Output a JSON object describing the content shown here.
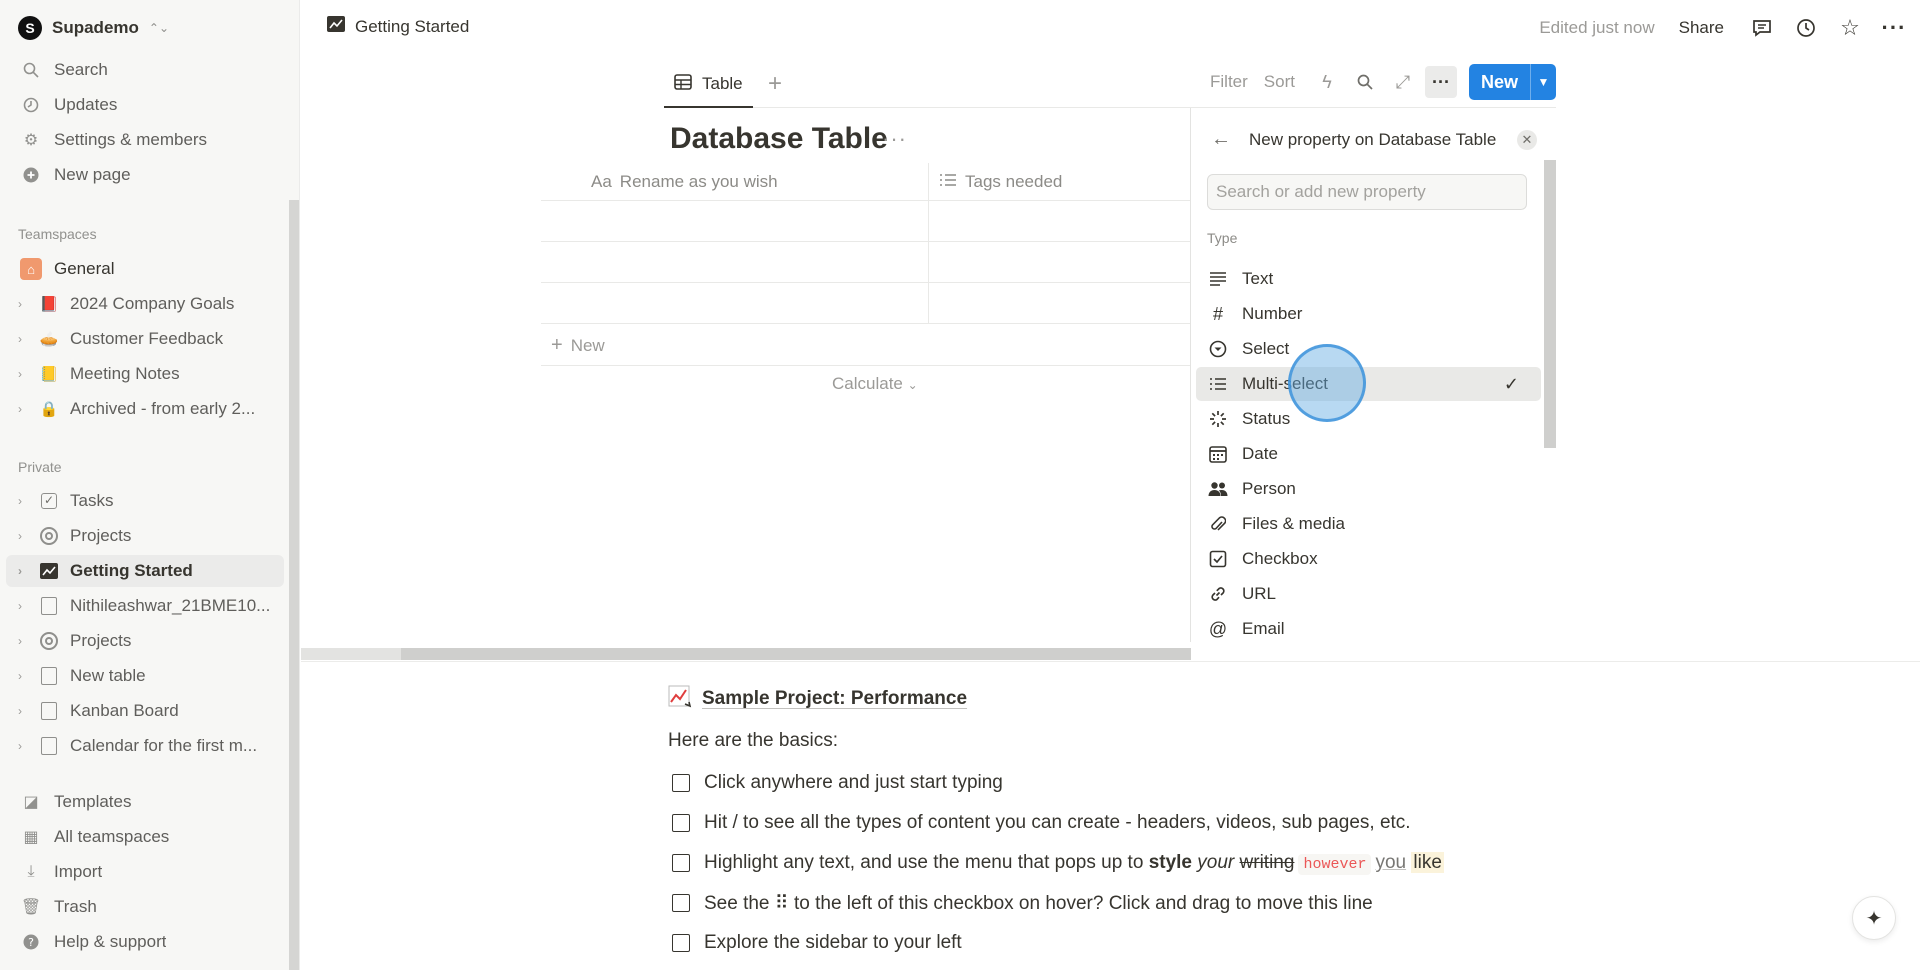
{
  "workspace": {
    "name": "Supademo",
    "logo_letter": "S"
  },
  "sidebar": {
    "top_items": [
      {
        "label": "Search",
        "icon": "search-icon"
      },
      {
        "label": "Updates",
        "icon": "clock-icon"
      },
      {
        "label": "Settings & members",
        "icon": "gear-icon"
      },
      {
        "label": "New page",
        "icon": "plus-circle-icon"
      }
    ],
    "teamspaces_label": "Teamspaces",
    "teamspaces": [
      {
        "label": "General",
        "icon": "home-icon"
      },
      {
        "label": "2024 Company Goals",
        "icon": "book-icon"
      },
      {
        "label": "Customer Feedback",
        "icon": "bowl-icon"
      },
      {
        "label": "Meeting Notes",
        "icon": "notebook-icon"
      },
      {
        "label": "Archived - from early 2...",
        "icon": "lock-icon"
      }
    ],
    "private_label": "Private",
    "private": [
      {
        "label": "Tasks",
        "icon": "checkbox-icon"
      },
      {
        "label": "Projects",
        "icon": "target-icon"
      },
      {
        "label": "Getting Started",
        "icon": "chart-icon"
      },
      {
        "label": "Nithileashwar_21BME10...",
        "icon": "page-icon"
      },
      {
        "label": "Projects",
        "icon": "target-icon"
      },
      {
        "label": "New table",
        "icon": "page-icon"
      },
      {
        "label": "Kanban Board",
        "icon": "page-icon"
      },
      {
        "label": "Calendar for the first m...",
        "icon": "page-icon"
      }
    ],
    "bottom_items": [
      {
        "label": "Templates",
        "icon": "templates-icon"
      },
      {
        "label": "All teamspaces",
        "icon": "building-icon"
      },
      {
        "label": "Import",
        "icon": "download-icon"
      },
      {
        "label": "Trash",
        "icon": "trash-icon"
      },
      {
        "label": "Help & support",
        "icon": "help-icon"
      }
    ]
  },
  "topbar": {
    "breadcrumb": "Getting Started",
    "edited": "Edited just now",
    "share": "Share"
  },
  "database": {
    "tab_label": "Table",
    "filter": "Filter",
    "sort": "Sort",
    "new_button": "New",
    "title": "Database Table",
    "columns": [
      {
        "label": "Rename as you wish",
        "icon_text": "Aa"
      },
      {
        "label": "Tags needed",
        "icon": "list-icon"
      }
    ],
    "new_row": "New",
    "calculate": "Calculate"
  },
  "panel": {
    "title": "New property on Database Table",
    "search_placeholder": "Search or add new property",
    "type_label": "Type",
    "types": [
      {
        "label": "Text",
        "icon": "text-icon"
      },
      {
        "label": "Number",
        "icon": "hash-icon"
      },
      {
        "label": "Select",
        "icon": "select-icon"
      },
      {
        "label": "Multi-select",
        "icon": "list-icon",
        "selected": true
      },
      {
        "label": "Status",
        "icon": "status-icon"
      },
      {
        "label": "Date",
        "icon": "calendar-icon"
      },
      {
        "label": "Person",
        "icon": "people-icon"
      },
      {
        "label": "Files & media",
        "icon": "paperclip-icon"
      },
      {
        "label": "Checkbox",
        "icon": "checkbox-icon"
      },
      {
        "label": "URL",
        "icon": "link-icon"
      },
      {
        "label": "Email",
        "icon": "at-icon"
      }
    ]
  },
  "content": {
    "project_title": "Sample Project: Performance",
    "basics": "Here are the basics:",
    "todos": {
      "t1": "Click anywhere and just start typing",
      "t2": "Hit / to see all the types of content you can create - headers, videos, sub pages, etc.",
      "t3_a": "Highlight any text, and use the menu that pops up to ",
      "t3_style": "style",
      "t3_your": "your",
      "t3_writing": "writing",
      "t3_however": "however",
      "t3_you": "you",
      "t3_like": "like",
      "t4": "See the ⠿ to the left of this checkbox on hover? Click and drag to move this line",
      "t5": "Explore the sidebar to your left"
    }
  },
  "colors": {
    "accent": "#2383e2",
    "sidebar_bg": "#f7f7f5",
    "selected_bg": "#e9e9e7"
  }
}
